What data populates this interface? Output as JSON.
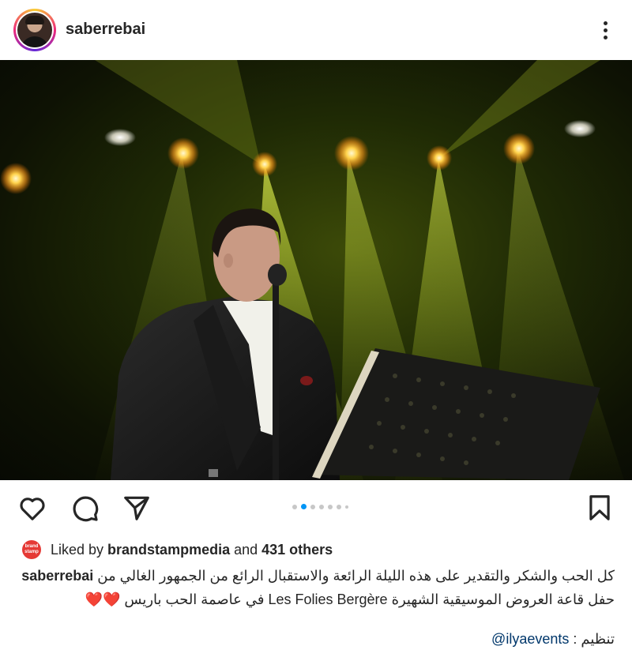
{
  "header": {
    "username": "saberrebai",
    "more_icon": "more-vertical-icon"
  },
  "photo": {
    "description_icon": "concert-photo"
  },
  "actions": {
    "like_icon": "heart-icon",
    "comment_icon": "comment-icon",
    "share_icon": "send-icon",
    "save_icon": "bookmark-icon",
    "carousel": {
      "total": 7,
      "active_index": 0
    }
  },
  "likes": {
    "prefix": "Liked by ",
    "liker": "brandstampmedia",
    "middle": " and ",
    "others": "431 others",
    "liker_avatar_text": "brand stamp"
  },
  "caption": {
    "username": "saberrebai",
    "text_line1": "كل الحب والشكر والتقدير على هذه الليلة الرائعة والاستقبال الرائع من الجمهور الغالي من",
    "text_line2": "حفل قاعة العروض الموسيقية الشهيرة Les Folies Bergère في عاصمة الحب باريس",
    "hearts": "❤️❤️",
    "organizer_label": "تنظيم : ",
    "organizer_mention": "@ilyaevents"
  },
  "colors": {
    "accent_blue": "#0095f6",
    "heart_red": "#e0245e",
    "mention_blue": "#00376b"
  }
}
